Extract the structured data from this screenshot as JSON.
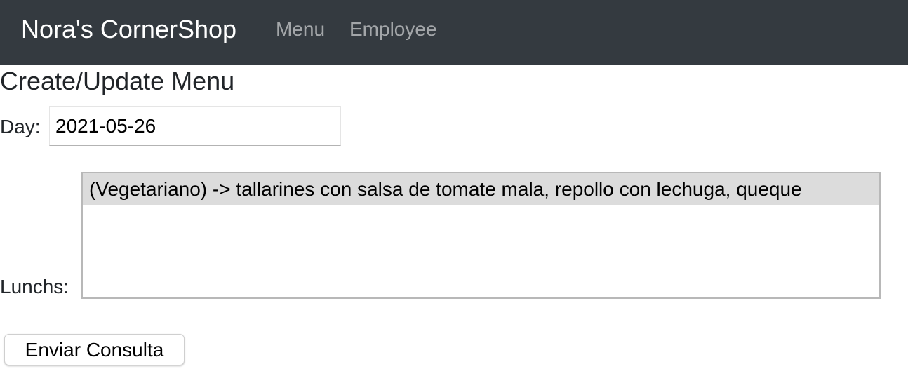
{
  "navbar": {
    "brand": "Nora's CornerShop",
    "links": [
      {
        "label": "Menu"
      },
      {
        "label": "Employee"
      }
    ]
  },
  "page": {
    "title": "Create/Update Menu"
  },
  "form": {
    "day_label": "Day:",
    "day_value": "2021-05-26",
    "lunchs_label": "Lunchs:",
    "lunch_options": [
      {
        "label": "(Vegetariano) -> tallarines con salsa de tomate mala, repollo con lechuga, queque",
        "selected": true
      }
    ],
    "submit_label": "Enviar Consulta"
  },
  "colors": {
    "navbar_bg": "#343a40",
    "selected_option_bg": "#dcdcdc"
  }
}
